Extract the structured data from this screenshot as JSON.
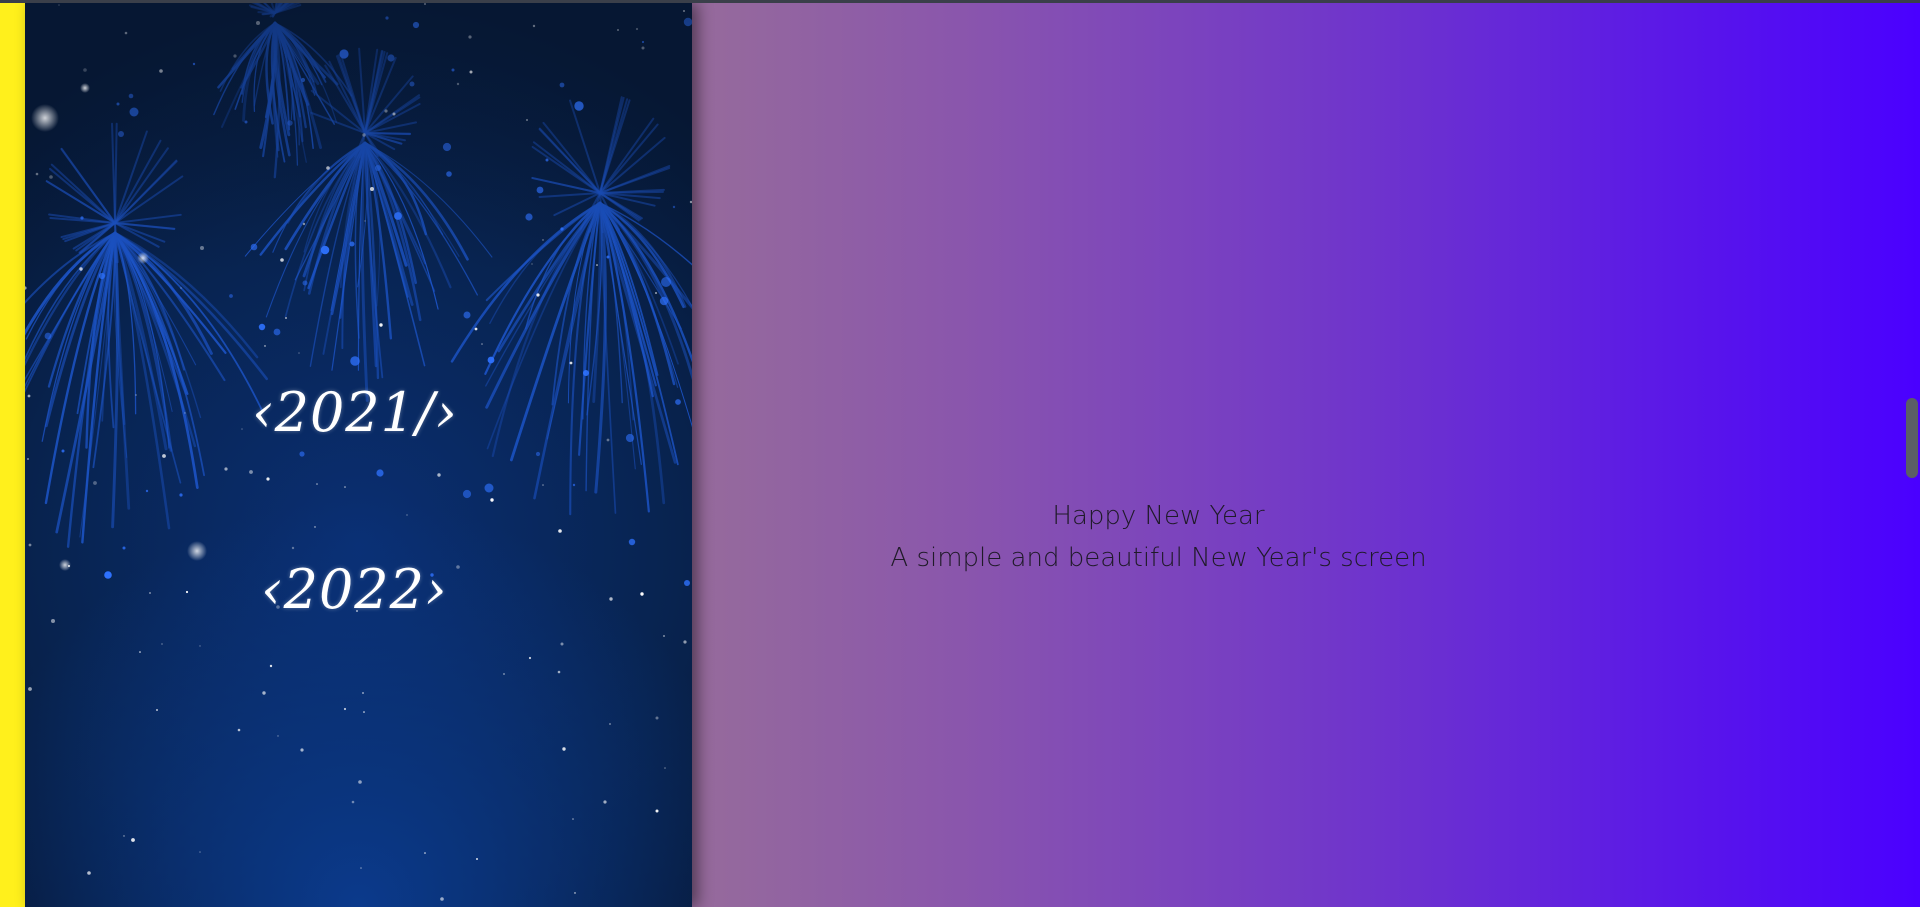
{
  "poster": {
    "year_previous": "‹2021/›",
    "year_next": "‹2022›"
  },
  "greeting": {
    "title": "Happy New Year",
    "subtitle": "A simple and beautiful New Year's screen"
  },
  "colors": {
    "left_strip": "#fff01c",
    "poster_background": "#08234f",
    "firework": "#1f5ad6",
    "gradient_start": "#c3a06c",
    "gradient_end": "#4a00ff"
  },
  "icons": {
    "fireworks": "fireworks-illustration-icon"
  }
}
